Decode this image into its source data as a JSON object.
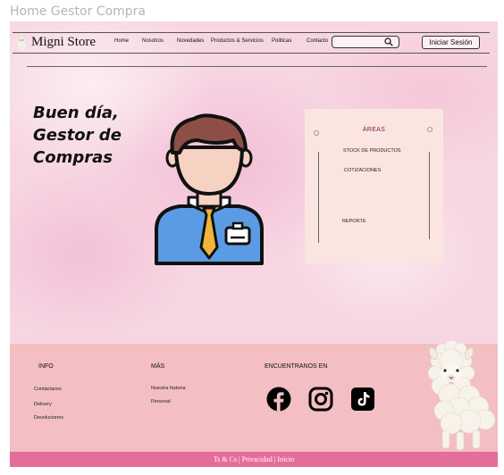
{
  "frame_title": "Home Gestor Compra",
  "brand": "Migni Store",
  "nav": {
    "items": [
      "Home",
      "Nosotros",
      "Novedades",
      "Productos & Servicios",
      "Politicas",
      "Contacto"
    ],
    "search_placeholder": "",
    "login_label": "Iniciar Sesión"
  },
  "greeting": {
    "line1": "Buen día,",
    "line2": "Gestor de",
    "line3": "Compras"
  },
  "areas": {
    "title": "ÁREAS",
    "items": [
      "STOCK DE PRODUCTOS",
      "COTIZACIONES",
      "REPORTE"
    ]
  },
  "footer": {
    "info_heading": "INFO",
    "info_links": [
      "Contáctanos",
      "Delivery",
      "Devoluciones"
    ],
    "more_heading": "MÁS",
    "more_links": [
      "Nuestra historia",
      "Personal"
    ],
    "social_heading": "ENCUENTRANOS EN",
    "social_icons": [
      "facebook-icon",
      "instagram-icon",
      "tiktok-icon"
    ],
    "bottom_links": "Ts & Cs |  Privacidad  | Inicio"
  },
  "colors": {
    "background": "#f7d6e3",
    "footer": "#f3bfc2",
    "bottom_bar": "#e56d9b",
    "panel": "#fbe5e1",
    "areas_title": "#7a1b46"
  }
}
